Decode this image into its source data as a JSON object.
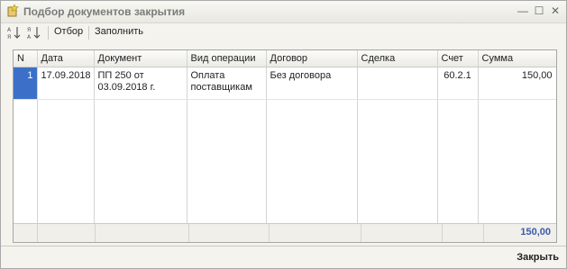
{
  "window": {
    "title": "Подбор документов закрытия",
    "controls": {
      "minimize": "—",
      "maximize": "☐",
      "close": "✕"
    }
  },
  "toolbar": {
    "sort_asc_icon": "sort-ascending-icon",
    "sort_desc_icon": "sort-descending-icon",
    "filter_label": "Отбор",
    "fill_label": "Заполнить"
  },
  "table": {
    "columns": [
      "N",
      "Дата",
      "Документ",
      "Вид операции",
      "Договор",
      "Сделка",
      "Счет",
      "Сумма"
    ],
    "rows": [
      {
        "n": "1",
        "date": "17.09.2018",
        "document": "ПП 250 от 03.09.2018 г.",
        "operation": "Оплата поставщикам",
        "contract": "Без договора",
        "deal": "",
        "account": "60.2.1",
        "amount": "150,00"
      }
    ],
    "total": "150,00"
  },
  "footer": {
    "close_label": "Закрыть"
  }
}
